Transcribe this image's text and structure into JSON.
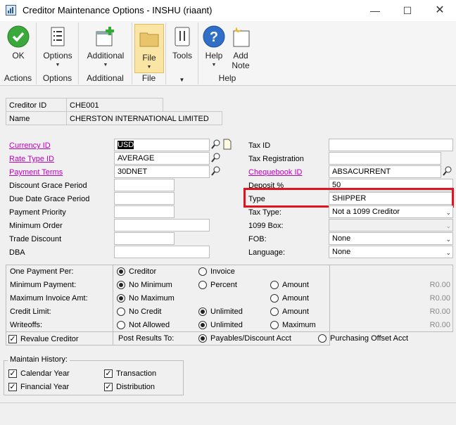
{
  "window": {
    "title": "Creditor Maintenance Options  -  INSHU (riaant)"
  },
  "ribbon": {
    "ok_label": "OK",
    "options_label": "Options",
    "additional_label": "Additional",
    "file_label": "File",
    "tools_label": "Tools",
    "help_label": "Help",
    "add_note_line1": "Add",
    "add_note_line2": "Note",
    "groups": {
      "actions": "Actions",
      "options": "Options",
      "additional": "Additional",
      "file": "File",
      "help": "Help"
    }
  },
  "header": {
    "creditor_id_label": "Creditor ID",
    "creditor_id": "CHE001",
    "name_label": "Name",
    "name": "CHERSTON INTERNATIONAL LIMITED"
  },
  "left": {
    "currency_id_label": "Currency ID",
    "currency_id": "USD",
    "rate_type_id_label": "Rate Type ID",
    "rate_type_id": "AVERAGE",
    "payment_terms_label": "Payment Terms",
    "payment_terms": "30DNET",
    "discount_grace_label": "Discount Grace Period",
    "due_date_grace_label": "Due Date Grace Period",
    "payment_priority_label": "Payment Priority",
    "minimum_order_label": "Minimum Order",
    "trade_discount_label": "Trade Discount",
    "dba_label": "DBA"
  },
  "right": {
    "tax_id_label": "Tax ID",
    "tax_registration_label": "Tax Registration",
    "chequebook_id_label": "Chequebook ID",
    "chequebook_id": "ABSACURRENT",
    "deposit_label": "Deposit %",
    "deposit": "50",
    "type_label": "Type",
    "type": "SHIPPER",
    "tax_type_label": "Tax Type:",
    "tax_type": "Not a 1099 Creditor",
    "box_1099_label": "1099 Box:",
    "fob_label": "FOB:",
    "fob": "None",
    "language_label": "Language:",
    "language": "None"
  },
  "options": {
    "one_payment_per": {
      "label": "One Payment Per:",
      "opt1": "Creditor",
      "opt2": "Invoice"
    },
    "minimum_payment": {
      "label": "Minimum Payment:",
      "opt1": "No Minimum",
      "opt2": "Percent",
      "opt3": "Amount",
      "value": "R0.00"
    },
    "max_invoice_amt": {
      "label": "Maximum Invoice Amt:",
      "opt1": "No Maximum",
      "opt3": "Amount",
      "value": "R0.00"
    },
    "credit_limit": {
      "label": "Credit Limit:",
      "opt1": "No Credit",
      "opt2": "Unlimited",
      "opt3": "Amount",
      "value": "R0.00"
    },
    "writeoffs": {
      "label": "Writeoffs:",
      "opt1": "Not Allowed",
      "opt2": "Unlimited",
      "opt3": "Maximum",
      "value": "R0.00"
    },
    "revalue_creditor": "Revalue Creditor",
    "post_results_to": {
      "label": "Post Results To:",
      "opt1": "Payables/Discount Acct",
      "opt2": "Purchasing Offset Acct"
    }
  },
  "history": {
    "title": "Maintain History:",
    "calendar_year": "Calendar Year",
    "transaction": "Transaction",
    "financial_year": "Financial Year",
    "distribution": "Distribution"
  },
  "colors": {
    "link": "#c000c0",
    "highlight": "#e0141e",
    "selection": "#000000"
  }
}
